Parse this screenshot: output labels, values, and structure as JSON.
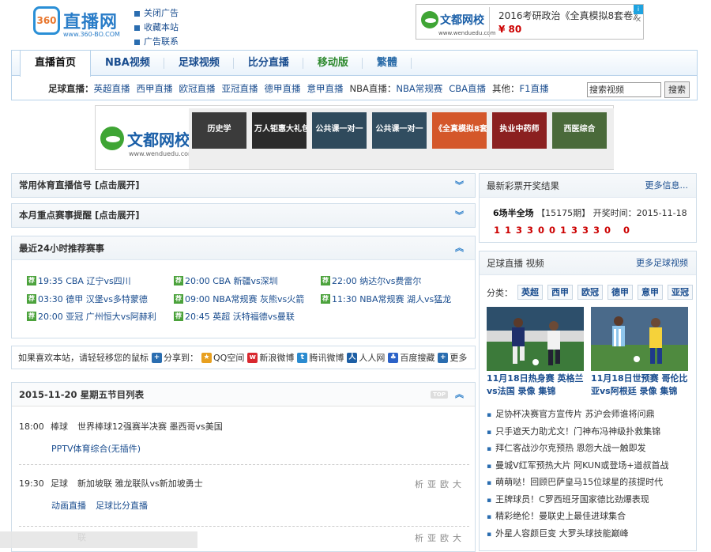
{
  "logo": {
    "badge": "360",
    "name": "直播网",
    "url": "www.360-BO.COM"
  },
  "toplinks": [
    "关闭广告",
    "收藏本站",
    "广告联系"
  ],
  "topad": {
    "brand": "文都网校",
    "domain": "www.wenduedu.com",
    "title": "2016考研政治《全真模拟8套卷》",
    "price": "¥ 80",
    "ad_icon": "i",
    "close": "✕"
  },
  "nav": {
    "tabs": [
      "直播首页",
      "NBA视频",
      "足球视频",
      "比分直播",
      "移动版",
      "繁體"
    ],
    "sub": {
      "football_label": "足球直播：",
      "football": [
        "英超直播",
        "西甲直播",
        "欧冠直播",
        "亚冠直播",
        "德甲直播",
        "意甲直播"
      ],
      "nba_label": "NBA直播：",
      "nba": [
        "NBA常规赛",
        "CBA直播"
      ],
      "other_label": "其他：",
      "other": [
        "F1直播"
      ]
    },
    "search_value": "搜索视频",
    "search_button": "搜索"
  },
  "banner": {
    "brand": "文都网校",
    "domain": "www.wenduedu.com",
    "thumbs": [
      {
        "text": "历史学",
        "color": "#3b3b3b"
      },
      {
        "text": "万人钜惠大礼包",
        "color": "#2b2b2b"
      },
      {
        "text": "公共课一对一",
        "color": "#2f4a5c"
      },
      {
        "text": "公共课一对一",
        "color": "#314d60"
      },
      {
        "text": "《全真模拟8套卷》",
        "color": "#d4572a"
      },
      {
        "text": "执业中药师",
        "color": "#8b2020"
      },
      {
        "text": "西医综合",
        "color": "#4a6a3a"
      }
    ]
  },
  "panels": {
    "p1": "常用体育直播信号 [点击展开]",
    "p2": "本月重点赛事提醒 [点击展开]",
    "p3": "最近24小时推荐赛事"
  },
  "recommend_badge": "荐",
  "recommend": [
    [
      "19:35 CBA 辽宁vs四川",
      "20:00 CBA 新疆vs深圳",
      "22:00 纳达尔vs费雷尔"
    ],
    [
      "03:30 德甲 汉堡vs多特蒙德",
      "09:00 NBA常规赛 灰熊vs火箭",
      "11:30 NBA常规赛 湖人vs猛龙"
    ],
    [
      "20:00 亚冠 广州恒大vs阿赫利",
      "20:45 英超 沃特福德vs曼联",
      ""
    ]
  ],
  "share": {
    "text": "如果喜欢本站，请轻轻移您的鼠标",
    "share_to": "分享到：",
    "items": [
      {
        "label": "QQ空间",
        "icon": "qzone-icon",
        "color": "#e8a020",
        "glyph": "★"
      },
      {
        "label": "新浪微博",
        "icon": "weibo-icon",
        "color": "#d9282f",
        "glyph": "w"
      },
      {
        "label": "腾讯微博",
        "icon": "tencent-weibo-icon",
        "color": "#2a8bd0",
        "glyph": "t"
      },
      {
        "label": "人人网",
        "icon": "renren-icon",
        "color": "#1d5fa5",
        "glyph": "人"
      },
      {
        "label": "百度搜藏",
        "icon": "baidu-icon",
        "color": "#2b62c8",
        "glyph": "♣"
      },
      {
        "label": "更多",
        "icon": "more-icon",
        "color": "#2a6db0",
        "glyph": "+"
      }
    ]
  },
  "schedule": {
    "title": "2015-11-20 星期五节目列表",
    "top_badge": "TOP",
    "items": [
      {
        "time": "18:00",
        "cat": "棒球",
        "title": "世界棒球12强赛半决赛 墨西哥vs美国",
        "links": [
          "PPTV体育综合(无插件)"
        ],
        "right": ""
      },
      {
        "time": "19:30",
        "cat": "足球",
        "title": "新加坡联 雅龙联队vs新加坡勇士",
        "links": [
          "动画直播",
          "足球比分直播"
        ],
        "right": "析亚欧大"
      },
      {
        "time": "",
        "cat": "",
        "title": "联",
        "links": [],
        "right": "析亚欧大"
      }
    ]
  },
  "lottery": {
    "title": "最新彩票开奖结果",
    "more": "更多信息...",
    "game": "6场半全场",
    "issue": "【15175期】",
    "draw_label": "开奖时间：",
    "draw_date": "2015-11-18",
    "numbers": "11330013330 0"
  },
  "video": {
    "title": "足球直播 视频",
    "more": "更多足球视频",
    "cat_label": "分类：",
    "cats": [
      "英超",
      "西甲",
      "欧冠",
      "德甲",
      "意甲",
      "亚冠"
    ],
    "captions": [
      "11月18日热身赛 英格兰vs法国 录像 集锦",
      "11月18日世预赛 哥伦比亚vs阿根廷 录像 集锦"
    ],
    "news": [
      "足协杯决赛官方宣传片 苏沪会师谁将问鼎",
      "只手遮天力助尤文！门神布冯神级扑救集锦",
      "拜仁客战沙尔克预热 恩怨大战一触即发",
      "曼城V红军预热大片 阿KUN或登场+道叔首战",
      "萌萌哒！回顾巴萨皇马15位球星的孩提时代",
      "王牌球员！C罗西班牙国家德比劲爆表现",
      "精彩绝伦！曼联史上最佳进球集合",
      "外星人容颜巨变 大罗头球技能巅峰"
    ]
  }
}
